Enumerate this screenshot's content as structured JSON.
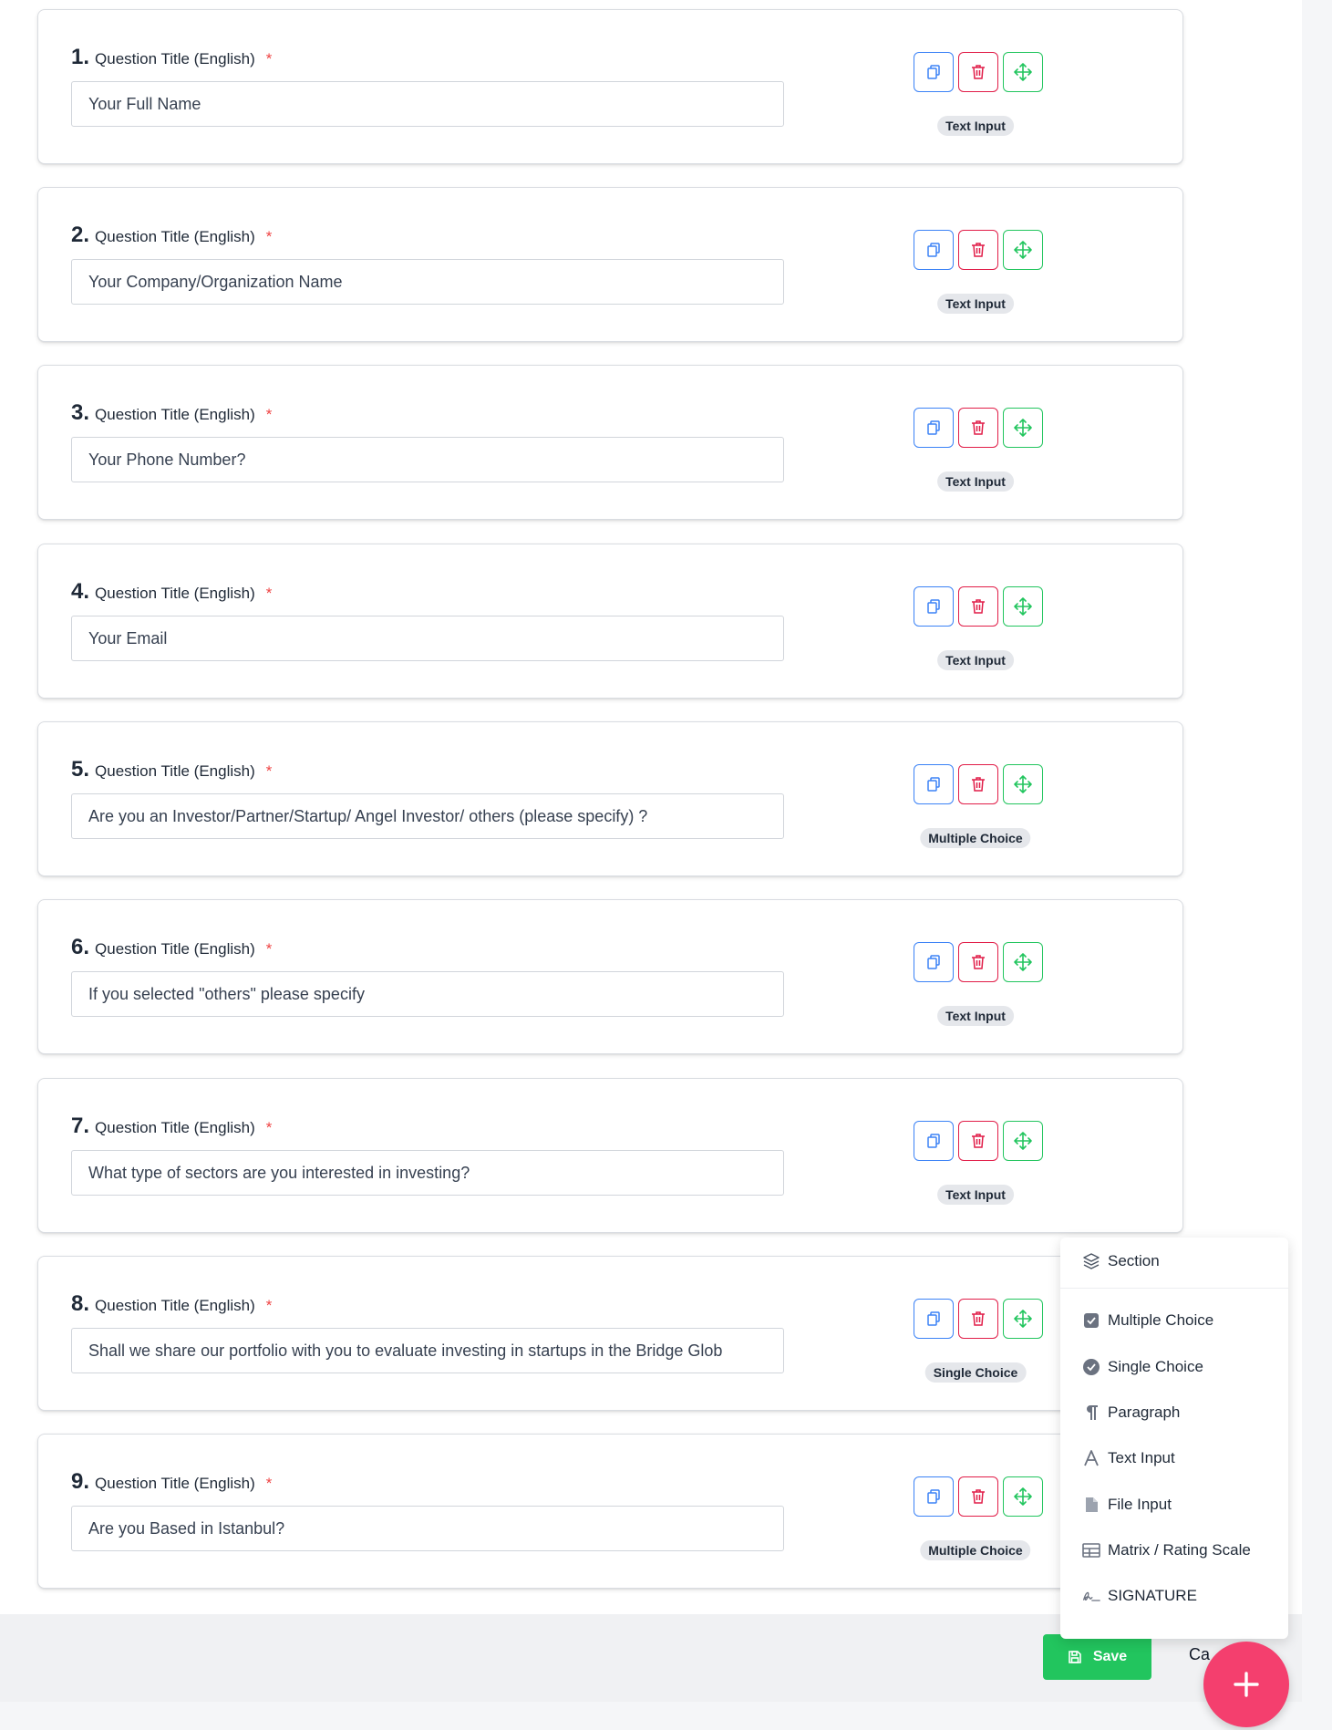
{
  "questions": [
    {
      "number": "1.",
      "label": "Question Title (English)",
      "required_mark": "*",
      "value": "Your Full Name",
      "type": "Text Input"
    },
    {
      "number": "2.",
      "label": "Question Title (English)",
      "required_mark": "*",
      "value": "Your Company/Organization Name",
      "type": "Text Input"
    },
    {
      "number": "3.",
      "label": "Question Title (English)",
      "required_mark": "*",
      "value": "Your Phone Number?",
      "type": "Text Input"
    },
    {
      "number": "4.",
      "label": "Question Title (English)",
      "required_mark": "*",
      "value": "Your Email",
      "type": "Text Input"
    },
    {
      "number": "5.",
      "label": "Question Title (English)",
      "required_mark": "*",
      "value": "Are you an Investor/Partner/Startup/ Angel Investor/ others (please specify) ?",
      "type": "Multiple Choice"
    },
    {
      "number": "6.",
      "label": "Question Title (English)",
      "required_mark": "*",
      "value": "If you selected \"others\" please specify",
      "type": "Text Input"
    },
    {
      "number": "7.",
      "label": "Question Title (English)",
      "required_mark": "*",
      "value": "What type of sectors are you interested in investing?",
      "type": "Text Input"
    },
    {
      "number": "8.",
      "label": "Question Title (English)",
      "required_mark": "*",
      "value": "Shall we share our portfolio with you to evaluate investing in startups in the Bridge Glob",
      "type": "Single Choice"
    },
    {
      "number": "9.",
      "label": "Question Title (English)",
      "required_mark": "*",
      "value": "Are you Based in Istanbul?",
      "type": "Multiple Choice"
    }
  ],
  "add_menu": {
    "section": {
      "label": "Section",
      "icon": "layers-icon"
    },
    "items": [
      {
        "label": "Multiple Choice",
        "icon": "checkbox-icon"
      },
      {
        "label": "Single Choice",
        "icon": "check-circle-icon"
      },
      {
        "label": "Paragraph",
        "icon": "pilcrow-icon"
      },
      {
        "label": "Text Input",
        "icon": "text-icon"
      },
      {
        "label": "File Input",
        "icon": "file-icon"
      },
      {
        "label": "Matrix / Rating Scale",
        "icon": "table-icon"
      },
      {
        "label": "SIGNATURE",
        "icon": "signature-icon"
      }
    ]
  },
  "footer": {
    "save_label": "Save",
    "cancel_label": "Ca"
  },
  "colors": {
    "copy": "#3b82f6",
    "delete": "#e11d48",
    "move": "#22c55e",
    "save": "#22c55e",
    "fab": "#f43f6e",
    "required": "#ef4444"
  }
}
